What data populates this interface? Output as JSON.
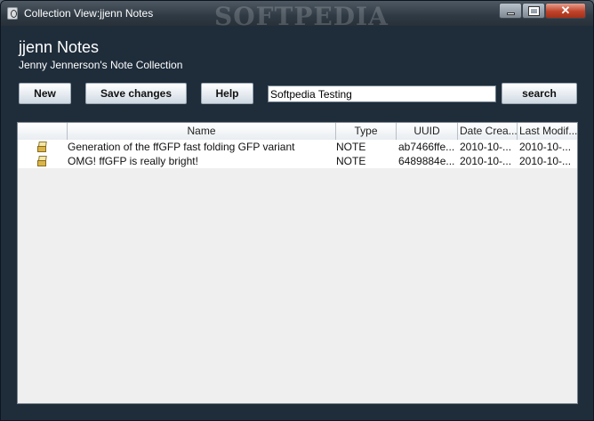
{
  "window": {
    "title": "Collection View:jjenn Notes",
    "watermark": "SOFTPEDIA",
    "controls": {
      "minimize_icon": "minimize-icon",
      "maximize_icon": "maximize-icon",
      "close_glyph": "✕"
    }
  },
  "header": {
    "title": "jjenn Notes",
    "subtitle": "Jenny Jennerson's Note Collection"
  },
  "toolbar": {
    "new_label": "New",
    "save_label": "Save changes",
    "help_label": "Help",
    "search_value": "Softpedia Testing",
    "search_label": "search"
  },
  "table": {
    "columns": [
      "",
      "Name",
      "Type",
      "UUID",
      "Date Crea...",
      "Last Modif..."
    ],
    "rows": [
      {
        "icon": "note-folder-icon",
        "name": "Generation of the ffGFP fast folding GFP variant",
        "type": "NOTE",
        "uuid": "ab7466ffe...",
        "created": "2010-10-...",
        "modified": "2010-10-..."
      },
      {
        "icon": "note-folder-icon",
        "name": "OMG!  ffGFP is really bright!",
        "type": "NOTE",
        "uuid": "6489884e...",
        "created": "2010-10-...",
        "modified": "2010-10-..."
      }
    ]
  },
  "colors": {
    "window_bg": "#1f2d3b",
    "table_bg": "#efefef",
    "close_button": "#c0432a"
  }
}
